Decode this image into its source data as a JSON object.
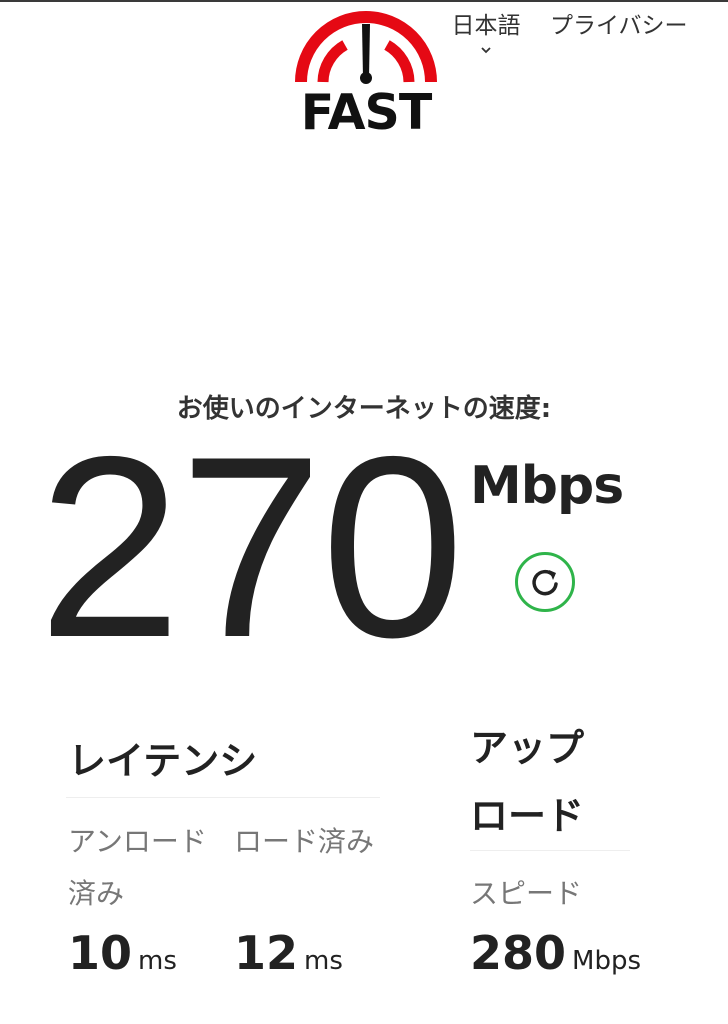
{
  "header": {
    "logo_text": "FAST",
    "language_label": "日本語",
    "privacy_label": "プライバシー"
  },
  "speed": {
    "caption": "お使いのインターネットの速度:",
    "value": "270",
    "unit": "Mbps"
  },
  "latency": {
    "title": "レイテンシ",
    "unloaded_label": "アンロード済み",
    "unloaded_value": "10",
    "unloaded_unit": "ms",
    "loaded_label": "ロード済み",
    "loaded_value": "12",
    "loaded_unit": "ms"
  },
  "upload": {
    "title": "アップロード",
    "speed_label": "スピード",
    "speed_value": "280",
    "speed_unit": "Mbps"
  },
  "colors": {
    "brand_red": "#e50914",
    "refresh_green": "#2fb44a",
    "text_dark": "#222222",
    "text_muted": "#777777"
  },
  "icons": {
    "logo": "speedometer-gauge-icon",
    "language_dropdown": "chevron-down-icon",
    "refresh": "refresh-icon"
  }
}
